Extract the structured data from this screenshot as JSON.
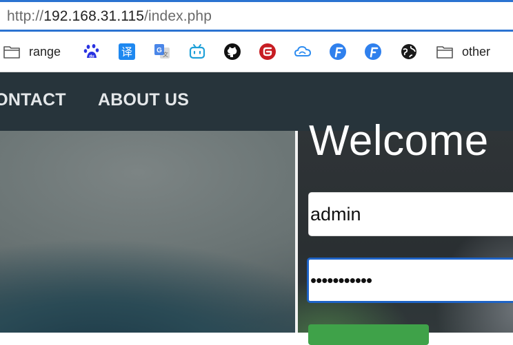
{
  "browser": {
    "url": {
      "scheme": "http://",
      "host": "192.168.31.115",
      "path": "/index.php"
    },
    "bookmarks": [
      {
        "icon": "folder-icon",
        "label": "range"
      },
      {
        "icon": "baidu-icon",
        "label": ""
      },
      {
        "icon": "translate-icon",
        "label": ""
      },
      {
        "icon": "google-translate-icon",
        "label": ""
      },
      {
        "icon": "bilibili-icon",
        "label": ""
      },
      {
        "icon": "github-icon",
        "label": ""
      },
      {
        "icon": "g-red-icon",
        "label": ""
      },
      {
        "icon": "cloud-icon",
        "label": ""
      },
      {
        "icon": "f-blue-icon",
        "label": ""
      },
      {
        "icon": "f-blue-icon",
        "label": ""
      },
      {
        "icon": "globe-icon",
        "label": ""
      },
      {
        "icon": "folder-icon",
        "label": "other"
      }
    ]
  },
  "site": {
    "nav": {
      "contact_label": "CONTACT",
      "about_label": "ABOUT US"
    },
    "login": {
      "heading": "Welcome",
      "username_value": "admin",
      "password_value": "•••••••••••"
    }
  },
  "colors": {
    "url_border": "#2b73d1",
    "navbar": "#27343b",
    "login_button": "#3fa249",
    "password_focus_border": "#1e63c6"
  }
}
